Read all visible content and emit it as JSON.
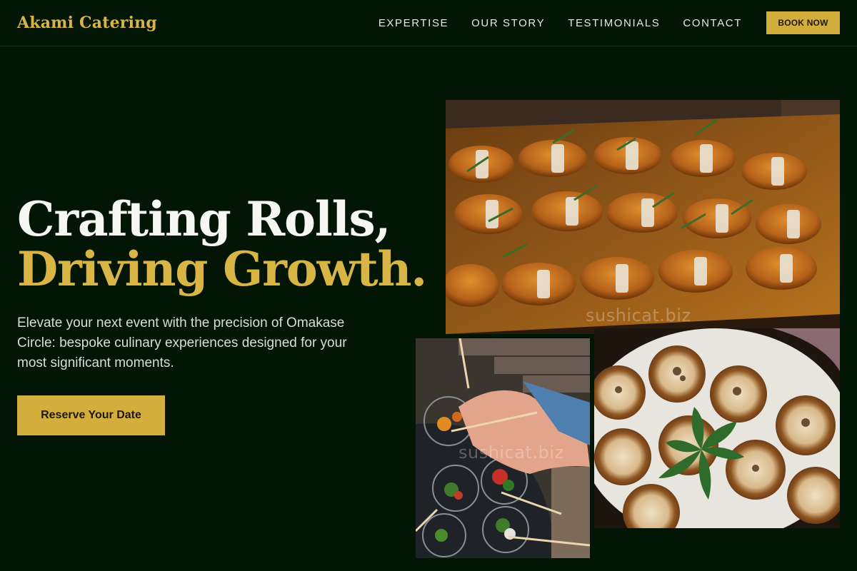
{
  "header": {
    "brand": "Akami Catering",
    "nav": [
      "EXPERTISE",
      "OUR STORY",
      "TESTIMONIALS",
      "CONTACT"
    ],
    "book_label": "BOOK NOW"
  },
  "hero": {
    "headline_line1": "Crafting Rolls,",
    "headline_line2": "Driving Growth.",
    "description": "Elevate your next event with the precision of Omakase Circle: bespoke culinary experiences designed for your most significant moments.",
    "cta_label": "Reserve Your Date"
  },
  "images": {
    "watermark": "sushicat.biz"
  },
  "colors": {
    "background": "#031605",
    "accent": "#d4ae3c",
    "headline_white": "#f6f6f2"
  }
}
